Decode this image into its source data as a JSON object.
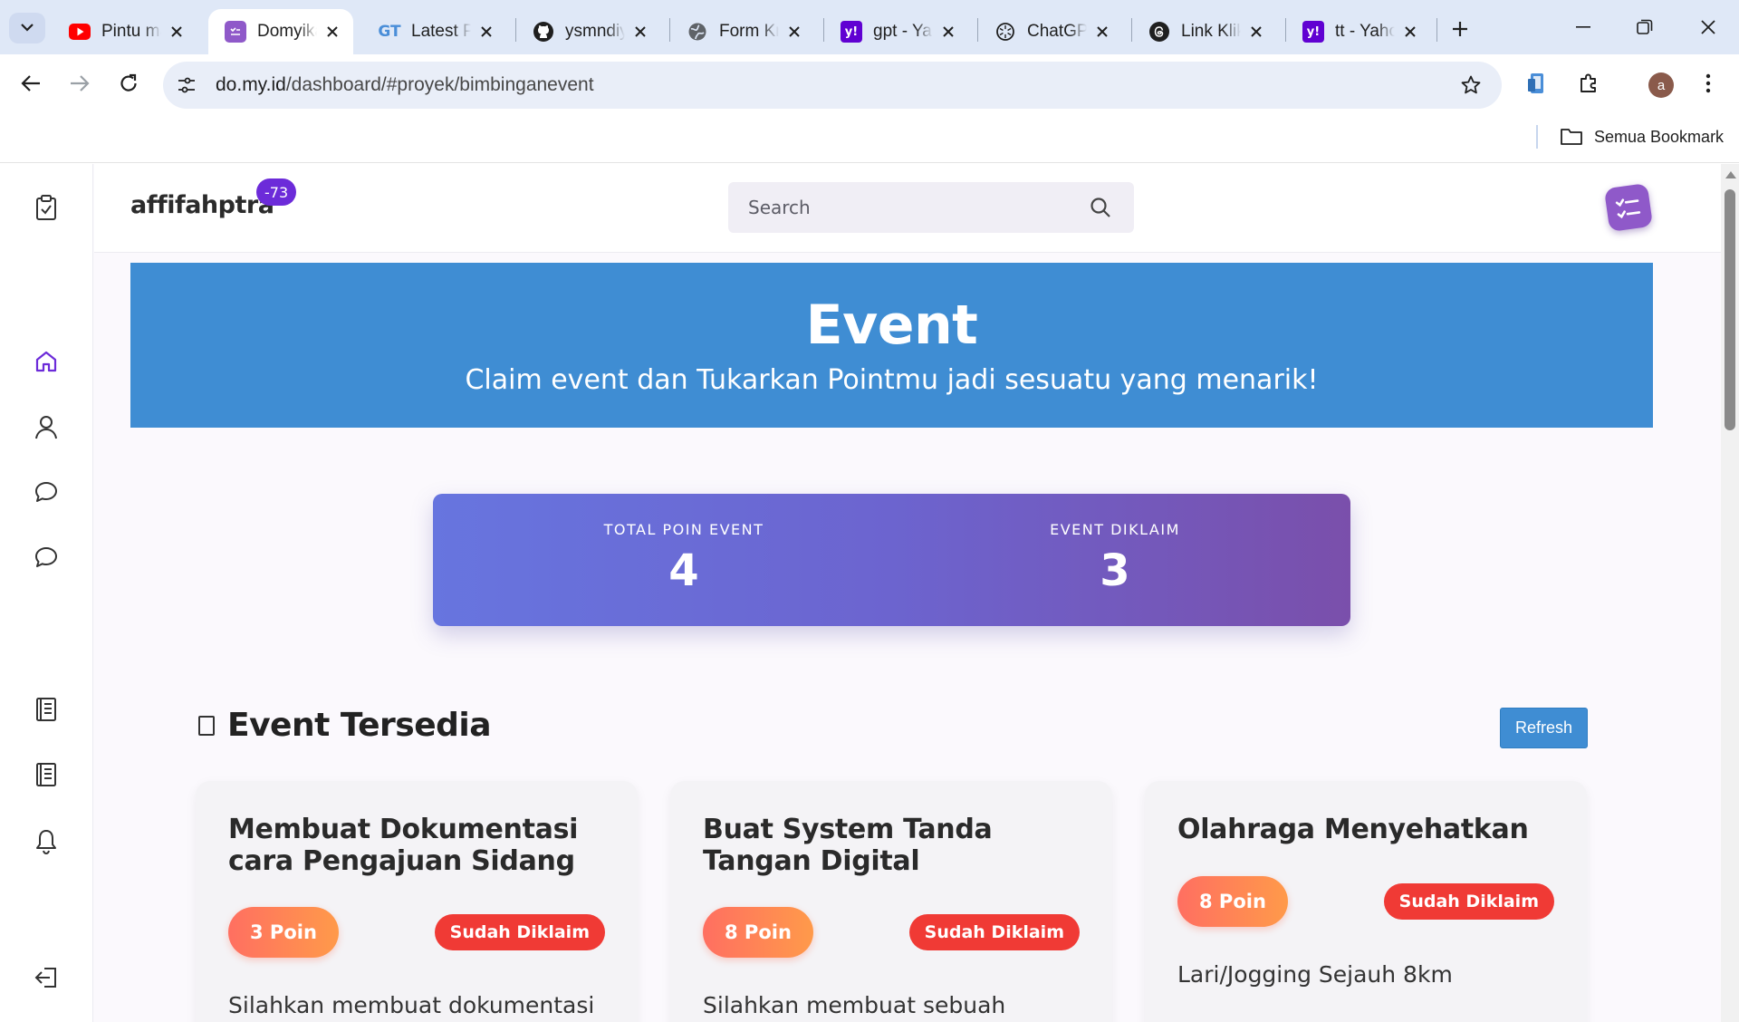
{
  "browser": {
    "tabs": [
      {
        "label": "Pintu ma",
        "icon": "youtube-icon"
      },
      {
        "label": "Domyika",
        "icon": "domyikado-icon",
        "active": true
      },
      {
        "label": "Latest P",
        "icon": "gt-icon"
      },
      {
        "label": "ysmndiy",
        "icon": "github-icon"
      },
      {
        "label": "Form Kr",
        "icon": "globe-icon"
      },
      {
        "label": "gpt - Ya",
        "icon": "yahoo-icon"
      },
      {
        "label": "ChatGP",
        "icon": "chatgpt-icon"
      },
      {
        "label": "Link Klik",
        "icon": "threads-icon"
      },
      {
        "label": "tt - Yaho",
        "icon": "yahoo-icon"
      }
    ],
    "url": {
      "host": "do.my.id",
      "path": "/dashboard/#proyek/bimbinganevent"
    },
    "profile_initial": "a",
    "bookmarks_label": "Semua Bookmark"
  },
  "sidebar": {
    "items": [
      {
        "icon": "clipboard-check-icon"
      },
      {
        "icon": "home-icon",
        "active": true,
        "color": "#6c2bd9"
      },
      {
        "icon": "user-icon"
      },
      {
        "icon": "chat-bubble-icon"
      },
      {
        "icon": "chat-bubble-icon"
      },
      {
        "icon": "book-icon"
      },
      {
        "icon": "book-icon"
      },
      {
        "icon": "bell-icon"
      },
      {
        "icon": "logout-icon"
      }
    ]
  },
  "header": {
    "username": "affifahptra",
    "badge": "-73",
    "search_placeholder": "Search"
  },
  "hero": {
    "title": "Event",
    "subtitle": "Claim event dan Tukarkan Pointmu jadi sesuatu yang menarik!",
    "color": "#3f8dd3"
  },
  "stats": {
    "total_label": "TOTAL POIN EVENT",
    "total_value": "4",
    "claimed_label": "EVENT DIKLAIM",
    "claimed_value": "3"
  },
  "events_section": {
    "title": "Event Tersedia",
    "refresh_label": "Refresh",
    "cards": [
      {
        "title": "Membuat Dokumentasi cara Pengajuan Sidang",
        "points": "3 Poin",
        "status": "Sudah Diklaim",
        "description": "Silahkan membuat dokumentasi"
      },
      {
        "title": "Buat System Tanda Tangan Digital",
        "points": "8 Poin",
        "status": "Sudah Diklaim",
        "description": "Silahkan membuat sebuah"
      },
      {
        "title": "Olahraga Menyehatkan",
        "points": "8 Poin",
        "status": "Sudah Diklaim",
        "description": "Lari/Jogging Sejauh 8km"
      }
    ]
  },
  "colors": {
    "accent": "#6c2bd9",
    "status_claimed": "#f03a35",
    "points_gradient_start": "#ff6f61",
    "points_gradient_end": "#ff9a4a"
  }
}
